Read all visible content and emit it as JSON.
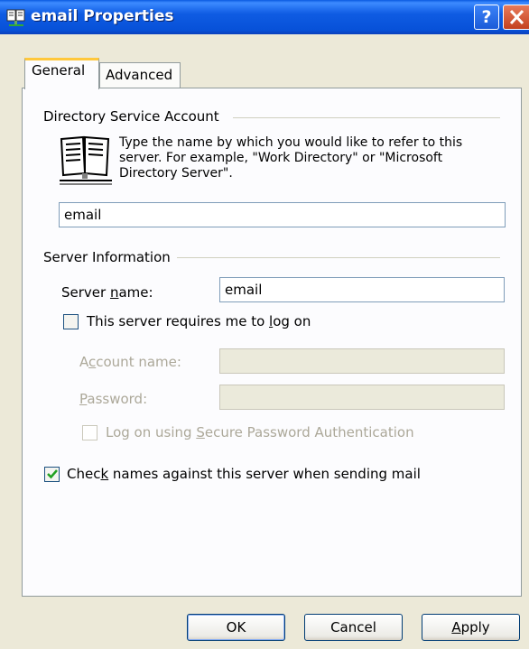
{
  "window": {
    "title": "email Properties",
    "help_button": "?",
    "close_button": "✕"
  },
  "tabs": [
    {
      "label": "General",
      "selected": true
    },
    {
      "label": "Advanced",
      "selected": false
    }
  ],
  "directory_service": {
    "group_label": "Directory Service Account",
    "description": "Type the name by which you would like to refer to this server. For example, \"Work Directory\" or \"Microsoft Directory Server\".",
    "account_display_name": "email",
    "icon": "address-book-icon"
  },
  "server_info": {
    "group_label": "Server Information",
    "server_name_label_pre": "Server ",
    "server_name_label_mn": "n",
    "server_name_label_post": "ame:",
    "server_name_value": "email",
    "requires_logon_pre": "This server requires me to ",
    "requires_logon_mn": "l",
    "requires_logon_post": "og on",
    "requires_logon_checked": false,
    "account_name_pre": "A",
    "account_name_mn": "c",
    "account_name_post": "count name:",
    "account_name_value": "",
    "password_mn": "P",
    "password_post": "assword:",
    "password_value": "",
    "spa_pre": "Log on using ",
    "spa_mn": "S",
    "spa_post": "ecure Password Authentication",
    "spa_checked": false
  },
  "check_names": {
    "pre": "Chec",
    "mn": "k",
    "post": " names against this server when sending mail",
    "checked": true
  },
  "buttons": {
    "ok": "OK",
    "cancel": "Cancel",
    "apply_mn": "A",
    "apply_post": "pply"
  }
}
